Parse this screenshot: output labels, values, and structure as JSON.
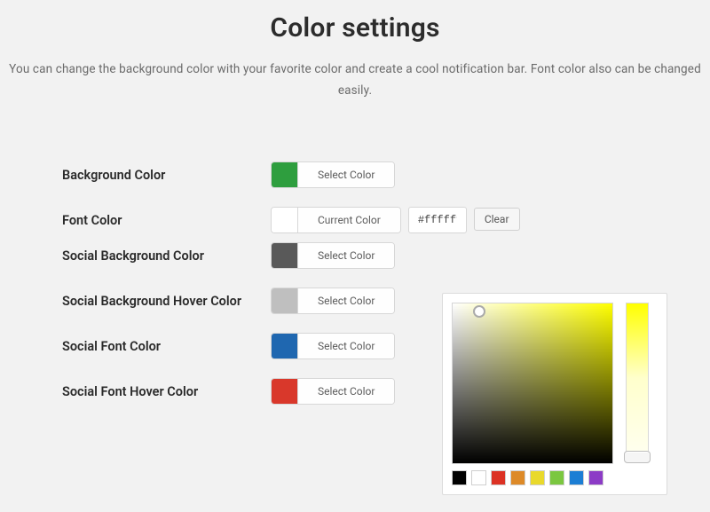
{
  "title": "Color settings",
  "subtitle": "You can change the background color with your favorite color and create a cool\nnotification bar. Font color also can be changed easily.",
  "rows": [
    {
      "label": "Background Color",
      "btn": "Select Color",
      "swatch": "#2e9e3e"
    },
    {
      "label": "Font Color",
      "btn": "Current Color",
      "swatch": "#ffffff",
      "hex": "#ffffff",
      "clear": "Clear"
    },
    {
      "label": "Social Background Color",
      "btn": "Select Color",
      "swatch": "#595959"
    },
    {
      "label": "Social Background Hover Color",
      "btn": "Select Color",
      "swatch": "#bfbfbf"
    },
    {
      "label": "Social Font Color",
      "btn": "Select Color",
      "swatch": "#1f67b0"
    },
    {
      "label": "Social Font Hover Color",
      "btn": "Select Color",
      "swatch": "#d9382b"
    }
  ],
  "palette": [
    "#000000",
    "#ffffff",
    "#dc3224",
    "#dd8a28",
    "#e9d92c",
    "#7bc740",
    "#1c7ed4",
    "#8c3bc6"
  ],
  "picker": {
    "hue_base": "#ffff00",
    "hue_gradient_end": "#ffffee"
  }
}
